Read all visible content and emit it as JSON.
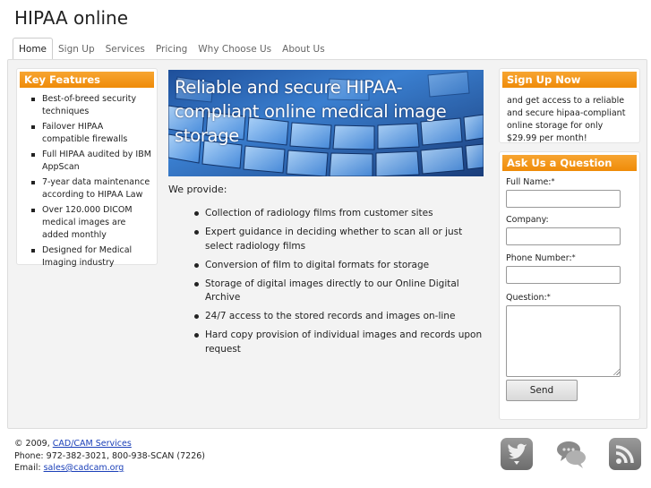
{
  "site": {
    "title": "HIPAA online"
  },
  "nav": {
    "tabs": [
      {
        "label": "Home"
      },
      {
        "label": "Sign Up"
      },
      {
        "label": "Services"
      },
      {
        "label": "Pricing"
      },
      {
        "label": "Why Choose Us"
      },
      {
        "label": "About Us"
      }
    ],
    "active": "Home"
  },
  "key_features": {
    "heading": "Key Features",
    "items": [
      "Best-of-breed security techniques",
      "Failover HIPAA compatible firewalls",
      "Full HIPAA audited by IBM AppScan",
      "7-year data maintenance according to HIPAA Law",
      "Over 120.000 DICOM medical images are added monthly",
      "Designed for Medical Imaging industry"
    ]
  },
  "hero": {
    "text": "Reliable and secure HIPAA-compliant online medical image storage"
  },
  "main": {
    "intro": "We provide:",
    "services": [
      "Collection of radiology films from customer sites",
      "Expert guidance in deciding whether to scan all or just select radiology films",
      "Conversion of film to digital formats for storage",
      "Storage of digital images directly to our Online Digital Archive",
      "24/7 access to the stored records and images on-line",
      "Hard copy provision of individual images and records upon request"
    ]
  },
  "signup": {
    "heading": "Sign Up Now",
    "text": "and get access to a reliable and secure hipaa-compliant online storage for only $29.99 per month!"
  },
  "ask": {
    "heading": "Ask Us a Question",
    "full_name_label": "Full Name:",
    "company_label": "Company:",
    "phone_label": "Phone Number:",
    "question_label": "Question:",
    "required_mark": "*",
    "full_name_value": "",
    "company_value": "",
    "phone_value": "",
    "question_value": "",
    "send_label": "Send"
  },
  "footer": {
    "copyright_prefix": "© 2009, ",
    "company_link": "CAD/CAM Services",
    "phone": "Phone: 972-382-3021, 800-938-SCAN (7226)",
    "email_prefix": "Email: ",
    "email_link": "sales@cadcam.org"
  },
  "social": [
    {
      "icon": "twitter-bird-icon"
    },
    {
      "icon": "chat-bubbles-icon"
    },
    {
      "icon": "rss-feed-icon"
    }
  ],
  "colors": {
    "accent_orange": "#ef8b08",
    "hero_blue": "#2a62b4",
    "link_blue": "#1a3fb8"
  }
}
